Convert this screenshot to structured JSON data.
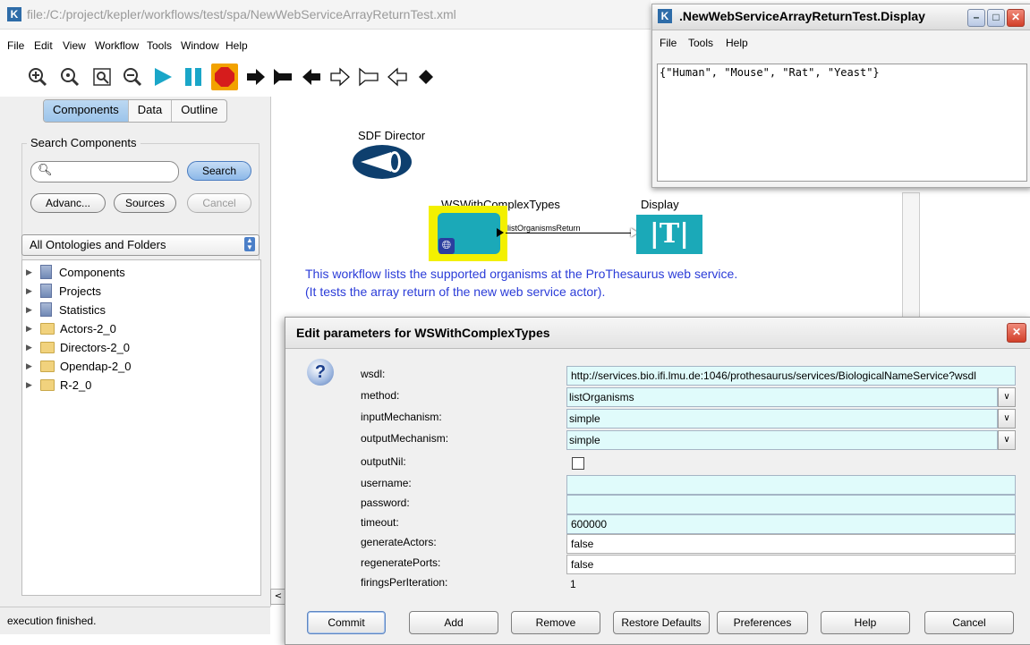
{
  "main_window": {
    "title": "file:/C:/project/kepler/workflows/test/spa/NewWebServiceArrayReturnTest.xml",
    "app_icon_letter": "K",
    "menu": [
      "File",
      "Edit",
      "View",
      "Workflow",
      "Tools",
      "Window",
      "Help"
    ]
  },
  "toolbar": {
    "icons": [
      "zoom-in-icon",
      "zoom-reset-icon",
      "zoom-fit-icon",
      "zoom-out-icon",
      "run-icon",
      "pause-icon",
      "stop-icon",
      "arrow-right-icon",
      "arrow-flag-icon",
      "arrow-left-icon",
      "outline-arrow-right-icon",
      "outline-arrow-flag-icon",
      "outline-arrow-left-icon",
      "diamond-icon"
    ]
  },
  "left_panel": {
    "tabs": [
      "Components",
      "Data",
      "Outline"
    ],
    "search_group_title": "Search Components",
    "search_value": "",
    "search_button": "Search",
    "advanced_button": "Advanc...",
    "sources_button": "Sources",
    "cancel_button": "Cancel",
    "ontology_select": "All Ontologies and Folders",
    "tree": [
      {
        "label": "Components",
        "icon": "doc"
      },
      {
        "label": "Projects",
        "icon": "doc"
      },
      {
        "label": "Statistics",
        "icon": "doc"
      },
      {
        "label": "Actors-2_0",
        "icon": "folder"
      },
      {
        "label": "Directors-2_0",
        "icon": "folder"
      },
      {
        "label": "Opendap-2_0",
        "icon": "folder"
      },
      {
        "label": "R-2_0",
        "icon": "folder"
      }
    ]
  },
  "status_text": "execution finished.",
  "canvas": {
    "director_label": "SDF Director",
    "actor_label": "WSWithComplexTypes",
    "port_label": "listOrganismsReturn",
    "display_label": "Display",
    "description_line1": "This workflow lists the supported organisms at the ProThesaurus web service.",
    "description_line2": "(It tests the array return of the new web service actor)."
  },
  "display_window": {
    "title": ".NewWebServiceArrayReturnTest.Display",
    "menu": [
      "File",
      "Tools",
      "Help"
    ],
    "output": "{\"Human\", \"Mouse\", \"Rat\", \"Yeast\"}"
  },
  "edit_dialog": {
    "title": "Edit parameters for WSWithComplexTypes",
    "params": {
      "wsdl": {
        "label": "wsdl:",
        "value": "http://services.bio.ifi.lmu.de:1046/prothesaurus/services/BiologicalNameService?wsdl"
      },
      "method": {
        "label": "method:",
        "value": "listOrganisms"
      },
      "inputMechanism": {
        "label": "inputMechanism:",
        "value": "simple"
      },
      "outputMechanism": {
        "label": "outputMechanism:",
        "value": "simple"
      },
      "outputNil": {
        "label": "outputNil:",
        "value": false
      },
      "username": {
        "label": "username:",
        "value": ""
      },
      "password": {
        "label": "password:",
        "value": ""
      },
      "timeout": {
        "label": "timeout:",
        "value": "600000"
      },
      "generateActors": {
        "label": "generateActors:",
        "value": "false"
      },
      "regeneratePorts": {
        "label": "regeneratePorts:",
        "value": "false"
      },
      "firingsPerIteration": {
        "label": "firingsPerIteration:",
        "value": "1"
      }
    },
    "buttons": {
      "commit": "Commit",
      "add": "Add",
      "remove": "Remove",
      "restore": "Restore Defaults",
      "preferences": "Preferences",
      "help": "Help",
      "cancel": "Cancel"
    }
  },
  "colors": {
    "accent_blue": "#2b5fa8",
    "description_blue": "#2b3cd8",
    "actor_teal": "#1ba9b8",
    "actor_highlight": "#f3f000",
    "field_cyan": "#e0fbfb",
    "close_red": "#d2402a"
  }
}
